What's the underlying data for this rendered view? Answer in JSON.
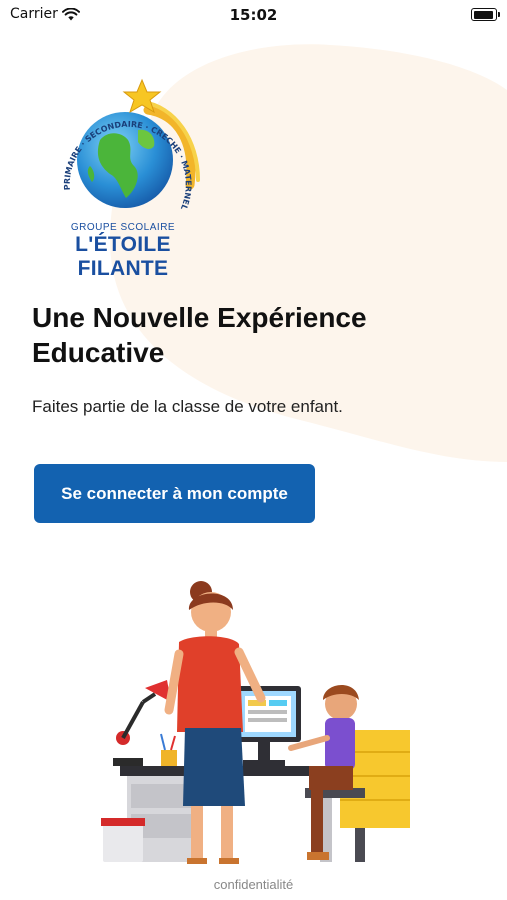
{
  "status_bar": {
    "carrier": "Carrier",
    "time": "15:02"
  },
  "logo": {
    "ring_text": "PRIMAIRE · SECONDAIRE · CRECHE · MATERNELLE",
    "group_label": "GROUPE SCOLAIRE",
    "school_name": "L'ÉTOILE FILANTE"
  },
  "main": {
    "headline_line1": "Une Nouvelle Expérience",
    "headline_line2": "Educative",
    "subtitle": "Faites partie de la classe de votre enfant.",
    "login_button_label": "Se connecter à mon compte"
  },
  "footer": {
    "privacy_label": "confidentialité"
  },
  "colors": {
    "accent": "#1362b0",
    "blob": "#fdf5ec"
  },
  "icons": {
    "wifi": "wifi-icon",
    "battery": "battery-icon"
  }
}
